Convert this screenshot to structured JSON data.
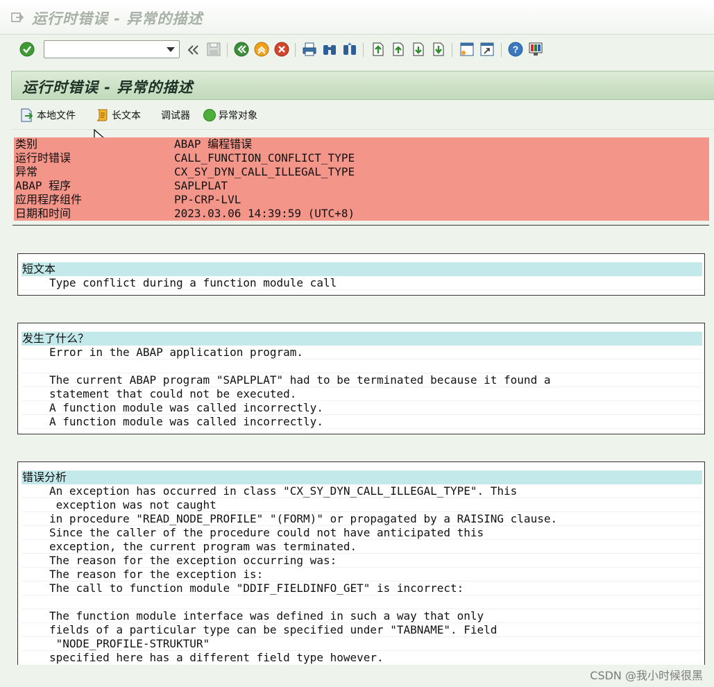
{
  "window": {
    "title": "运行时错误 - 异常的描述"
  },
  "toolbar": {
    "command_field_value": "",
    "icons": [
      "enter-icon",
      "back-double-arrow-icon",
      "save-icon",
      "back-icon",
      "exit-icon",
      "cancel-icon",
      "print-icon",
      "find-icon",
      "find-next-icon",
      "first-page-icon",
      "previous-page-icon",
      "next-page-icon",
      "last-page-icon",
      "create-session-icon",
      "shortcut-icon",
      "help-icon",
      "layout-icon"
    ]
  },
  "screen": {
    "header": "运行时错误 - 异常的描述"
  },
  "app_toolbar": {
    "local_file": "本地文件",
    "long_text": "长文本",
    "debugger": "调试器",
    "exception_object": "异常对象"
  },
  "error_info": [
    {
      "key": "类别",
      "value": "ABAP 编程错误"
    },
    {
      "key": "运行时错误",
      "value": "CALL_FUNCTION_CONFLICT_TYPE"
    },
    {
      "key": "异常",
      "value": "CX_SY_DYN_CALL_ILLEGAL_TYPE"
    },
    {
      "key": "ABAP 程序",
      "value": "SAPLPLAT"
    },
    {
      "key": "应用程序组件",
      "value": "PP-CRP-LVL"
    },
    {
      "key": "日期和时间",
      "value": "2023.03.06 14:39:59 (UTC+8)"
    }
  ],
  "sections": {
    "short_text": {
      "caption": "短文本",
      "lines": [
        "Type conflict during a function module call"
      ]
    },
    "what_happened": {
      "caption": "发生了什么？",
      "lines": [
        "Error in the ABAP application program.",
        "",
        "The current ABAP program \"SAPLPLAT\" had to be terminated because it found a",
        "statement that could not be executed.",
        "A function module was called incorrectly.",
        "A function module was called incorrectly."
      ]
    },
    "error_analysis": {
      "caption": "错误分析",
      "lines": [
        "An exception has occurred in class \"CX_SY_DYN_CALL_ILLEGAL_TYPE\". This",
        " exception was not caught",
        "in procedure \"READ_NODE_PROFILE\" \"(FORM)\" or propagated by a RAISING clause.",
        "Since the caller of the procedure could not have anticipated this",
        "exception, the current program was terminated.",
        "The reason for the exception occurring was:",
        "The reason for the exception is:",
        "The call to function module \"DDIF_FIELDINFO_GET\" is incorrect:",
        "",
        "The function module interface was defined in such a way that only",
        "fields of a particular type can be specified under \"TABNAME\". Field",
        " \"NODE_PROFILE-STRUKTUR\"",
        "specified here has a different field type however."
      ]
    }
  },
  "watermark": "CSDN @我小时候很黑"
}
